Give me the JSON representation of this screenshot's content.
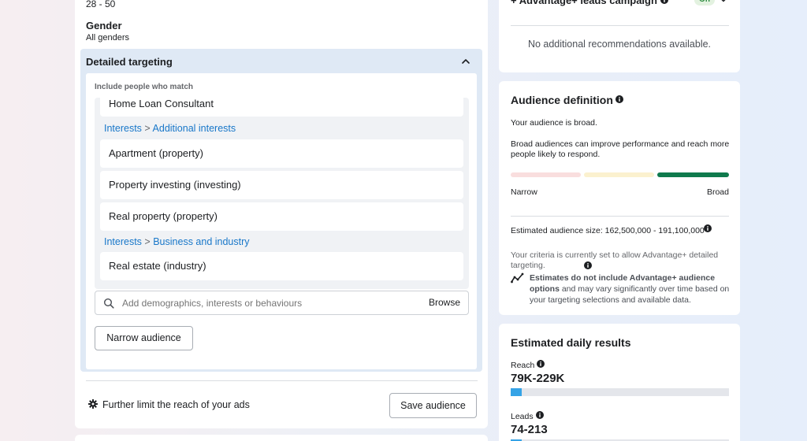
{
  "audience": {
    "age_range": "28 - 50",
    "gender": {
      "title": "Gender",
      "value": "All genders"
    }
  },
  "detailed_targeting": {
    "title": "Detailed targeting",
    "include_label": "Include people who match",
    "items": [
      {
        "type": "item",
        "label": "Home Loan Consultant"
      },
      {
        "type": "category",
        "parent": "Interests",
        "separator": ">",
        "child": "Additional interests"
      },
      {
        "type": "item",
        "label": "Apartment (property)"
      },
      {
        "type": "item",
        "label": "Property investing (investing)"
      },
      {
        "type": "item",
        "label": "Real property (property)"
      },
      {
        "type": "category",
        "parent": "Interests",
        "separator": ">",
        "child": "Business and industry"
      },
      {
        "type": "item",
        "label": "Real estate (industry)"
      }
    ],
    "search": {
      "placeholder": "Add demographics, interests or behaviours",
      "browse_label": "Browse"
    },
    "narrow_button": "Narrow audience"
  },
  "footer": {
    "further_limit": "Further limit the reach of your ads",
    "save_button": "Save audience"
  },
  "advantage": {
    "title": "+ Advantage+ leads campaign",
    "toggle": "On",
    "no_recommendations": "No additional recommendations available."
  },
  "audience_definition": {
    "title": "Audience definition",
    "status": "Your audience is broad.",
    "description": "Broad audiences can improve performance and reach more people likely to respond.",
    "narrow_label": "Narrow",
    "broad_label": "Broad",
    "estimated_size": "Estimated audience size: 162,500,000 - 191,100,000",
    "criteria": "Your criteria is currently set to allow Advantage+ detailed targeting.",
    "estimate_note_bold": "Estimates do not include Advantage+ audience options",
    "estimate_note_rest": " and may vary significantly over time based on your targeting selections and available data."
  },
  "daily_results": {
    "title": "Estimated daily results",
    "reach": {
      "label": "Reach",
      "value": "79K-229K",
      "fill_fraction": 0.05
    },
    "leads": {
      "label": "Leads",
      "value": "74-213",
      "fill_fraction": 0.05
    }
  },
  "colors": {
    "link": "#1877c9",
    "meter_narrow": "#f9dede",
    "meter_mid": "#fbf1cf",
    "meter_broad": "#0f7a4d",
    "result_bar": "#35a3e6"
  }
}
